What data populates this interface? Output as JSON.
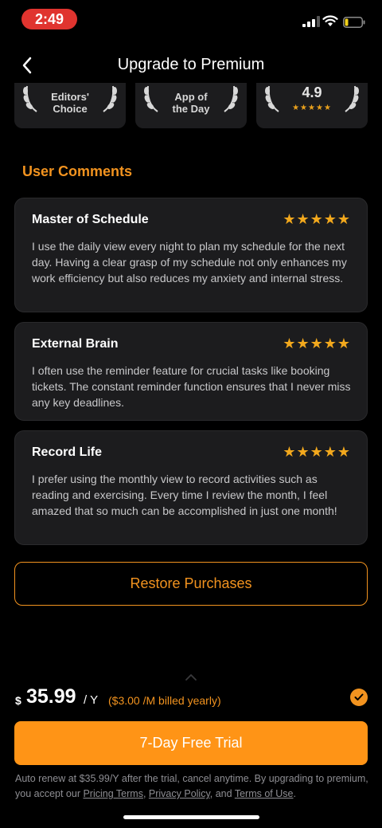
{
  "status_bar": {
    "time": "2:49"
  },
  "nav": {
    "title": "Upgrade to Premium"
  },
  "awards": [
    {
      "line1": "Editors'",
      "line2": "Choice"
    },
    {
      "line1": "App of",
      "line2": "the Day"
    },
    {
      "rating": "4.9",
      "stars": "★★★★★"
    }
  ],
  "section_title": "User Comments",
  "comments": [
    {
      "title": "Master of Schedule",
      "stars": "★★★★★",
      "body": "I use the daily view every night to plan my schedule for the next day. Having a clear grasp of my schedule not only enhances my work efficiency but also reduces my anxiety and internal stress."
    },
    {
      "title": "External Brain",
      "stars": "★★★★★",
      "body": "I often use the reminder feature for crucial tasks like booking tickets. The constant reminder function ensures that I never miss any key deadlines."
    },
    {
      "title": "Record Life",
      "stars": "★★★★★",
      "body": "I prefer using the monthly view to record activities such as reading and exercising. Every time I review the month, I feel amazed that so much can be accomplished in just one month!"
    }
  ],
  "restore_label": "Restore Purchases",
  "plan": {
    "currency": "$",
    "amount": "35.99",
    "period": "/ Y",
    "monthly_note": "($3.00 /M billed yearly)"
  },
  "trial_label": "7-Day Free Trial",
  "legal": {
    "prefix": "Auto renew at $35.99/Y after the trial, cancel anytime. By upgrading to premium, you accept our ",
    "pricing_terms": "Pricing Terms",
    "sep1": ", ",
    "privacy_policy": "Privacy Policy",
    "sep2": ", and ",
    "terms_of_use": "Terms of Use",
    "suffix": "."
  },
  "colors": {
    "accent": "#f2931f",
    "button": "#ff9416",
    "card": "#1c1c1e",
    "time_pill": "#e0342f"
  }
}
